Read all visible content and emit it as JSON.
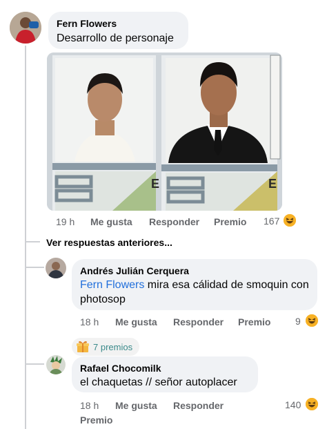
{
  "comment_main": {
    "author": "Fern Flowers",
    "text": "Desarrollo de personaje",
    "time": "19 h",
    "like_label": "Me gusta",
    "reply_label": "Responder",
    "award_label": "Premio",
    "reaction_count": "167",
    "photo_id_letter": "E"
  },
  "view_previous": "Ver respuestas anteriores...",
  "reply_1": {
    "author": "Andrés Julián Cerquera",
    "mention": "Fern Flowers",
    "text_after_mention": " mira esa cálidad de smoquin con photosop",
    "time": "18 h",
    "like_label": "Me gusta",
    "reply_label": "Responder",
    "award_label": "Premio",
    "reaction_count": "9"
  },
  "reply_2": {
    "awards_badge": "7 premios",
    "author": "Rafael Chocomilk",
    "text": "el chaquetas // señor autoplacer",
    "time": "18 h",
    "like_label": "Me gusta",
    "reply_label": "Responder",
    "award_label": "Premio",
    "reaction_count": "140"
  },
  "colors": {
    "bubble": "#f0f2f5",
    "action_text": "#65676b",
    "mention": "#216fdb",
    "thread_line": "#ced0d4",
    "haha_reaction": "#f7b125"
  }
}
